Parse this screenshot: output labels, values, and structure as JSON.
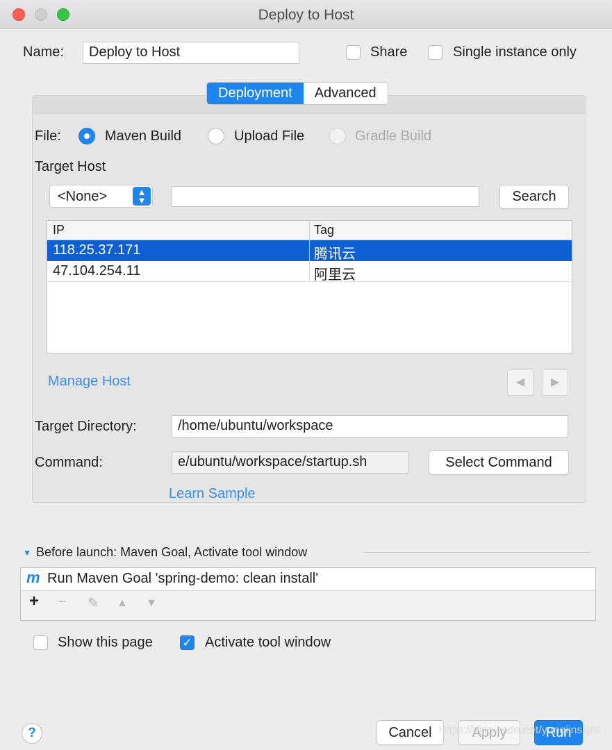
{
  "window": {
    "title": "Deploy to Host"
  },
  "top": {
    "name_label": "Name:",
    "name_value": "Deploy to Host",
    "share_label": "Share",
    "single_instance_label": "Single instance only"
  },
  "tabs": [
    {
      "label": "Deployment",
      "active": true
    },
    {
      "label": "Advanced",
      "active": false
    }
  ],
  "file": {
    "label": "File:",
    "options": [
      {
        "label": "Maven Build",
        "selected": true,
        "enabled": true
      },
      {
        "label": "Upload File",
        "selected": false,
        "enabled": true
      },
      {
        "label": "Gradle Build",
        "selected": false,
        "enabled": false
      }
    ]
  },
  "target_host": {
    "label": "Target Host",
    "select_value": "<None>",
    "search_value": "",
    "search_button": "Search",
    "columns": [
      "IP",
      "Tag"
    ],
    "rows": [
      {
        "ip": "118.25.37.171",
        "tag": "腾讯云",
        "selected": true
      },
      {
        "ip": "47.104.254.11",
        "tag": "阿里云",
        "selected": false
      }
    ],
    "manage_link": "Manage Host"
  },
  "target_directory": {
    "label": "Target Directory:",
    "value": "/home/ubuntu/workspace"
  },
  "command": {
    "label": "Command:",
    "value": "e/ubuntu/workspace/startup.sh",
    "button": "Select Command"
  },
  "learn_sample": "Learn Sample",
  "before_launch": {
    "header": "Before launch: Maven Goal, Activate tool window",
    "item_icon": "m",
    "item_label": "Run Maven Goal 'spring-demo: clean install'",
    "toolbar": {
      "add": "+",
      "remove": "−",
      "edit": "✎",
      "up": "▲",
      "down": "▼"
    }
  },
  "options": {
    "show_page_label": "Show this page",
    "show_page_checked": false,
    "activate_tool_label": "Activate tool window",
    "activate_tool_checked": true
  },
  "footer": {
    "help": "?",
    "cancel": "Cancel",
    "apply": "Apply",
    "run": "Run",
    "watermark": "https://blog.csdn.net/yunqiinsight"
  },
  "colors": {
    "accent": "#1f86f0",
    "selection": "#0f5fd4",
    "link": "#3a8fe6"
  }
}
